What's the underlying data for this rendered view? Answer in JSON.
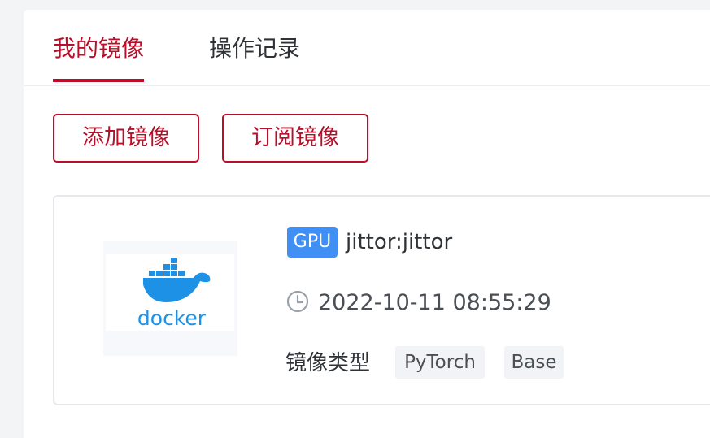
{
  "tabs": [
    {
      "label": "我的镜像",
      "active": true
    },
    {
      "label": "操作记录",
      "active": false
    }
  ],
  "actions": {
    "add_image": "添加镜像",
    "subscribe_image": "订阅镜像"
  },
  "image_card": {
    "logo_text": "docker",
    "badge": "GPU",
    "name": "jittor:jittor",
    "created_at": "2022-10-11 08:55:29",
    "type_label": "镜像类型",
    "tags": [
      "PyTorch",
      "Base"
    ]
  },
  "icons": {
    "logo": "docker-logo-icon",
    "time": "clock-icon"
  },
  "colors": {
    "accent": "#b8102a",
    "badge": "#3f8ff5",
    "docker_blue": "#1d91e6",
    "tag_bg": "#f1f3f6"
  }
}
